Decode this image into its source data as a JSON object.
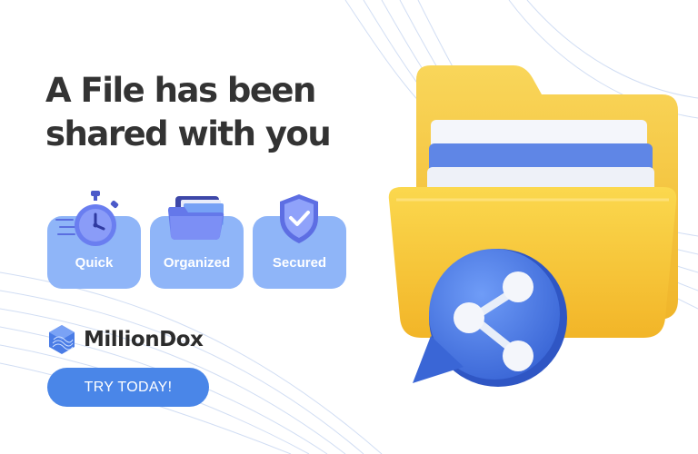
{
  "headline": {
    "line1": "A File has been",
    "line2": "shared with you"
  },
  "features": [
    {
      "label": "Quick",
      "icon": "stopwatch-icon"
    },
    {
      "label": "Organized",
      "icon": "folder-icon"
    },
    {
      "label": "Secured",
      "icon": "shield-check-icon"
    }
  ],
  "brand": {
    "name": "MillionDox",
    "logo": "milliondox-logo"
  },
  "cta": {
    "label": "TRY TODAY!"
  },
  "hero": {
    "icon": "shared-folder-icon"
  },
  "colors": {
    "background": "#ffffff",
    "headline": "#333333",
    "card": "#8fb5f8",
    "accent": "#4a86e8",
    "folder": "#f7c93a",
    "share_badge": "#4a7ce6"
  }
}
